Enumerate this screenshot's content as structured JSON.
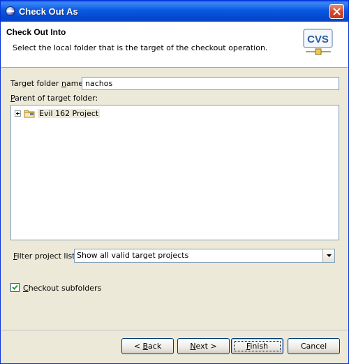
{
  "window": {
    "title": "Check Out As",
    "close_label": ""
  },
  "header": {
    "title": "Check Out Into",
    "description": "Select the local folder that is the target of the checkout operation.",
    "logo_text": "CVS"
  },
  "form": {
    "target_folder_label": "Target folder name:",
    "target_folder_value": "nachos",
    "parent_label": "Parent of target folder:",
    "tree": [
      {
        "label": "Evil 162 Project",
        "expanded": false
      }
    ],
    "filter_label": "Filter project list:",
    "filter_value": "Show all valid target projects",
    "checkout_subfolders_label": "Checkout subfolders",
    "checkout_subfolders_checked": true
  },
  "buttons": {
    "back": "< Back",
    "next": "Next >",
    "finish": "Finish",
    "cancel": "Cancel"
  },
  "colors": {
    "titlebar": "#0A5AE0",
    "dialog_bg": "#ECE9D8",
    "field_border": "#7F9DB9"
  }
}
